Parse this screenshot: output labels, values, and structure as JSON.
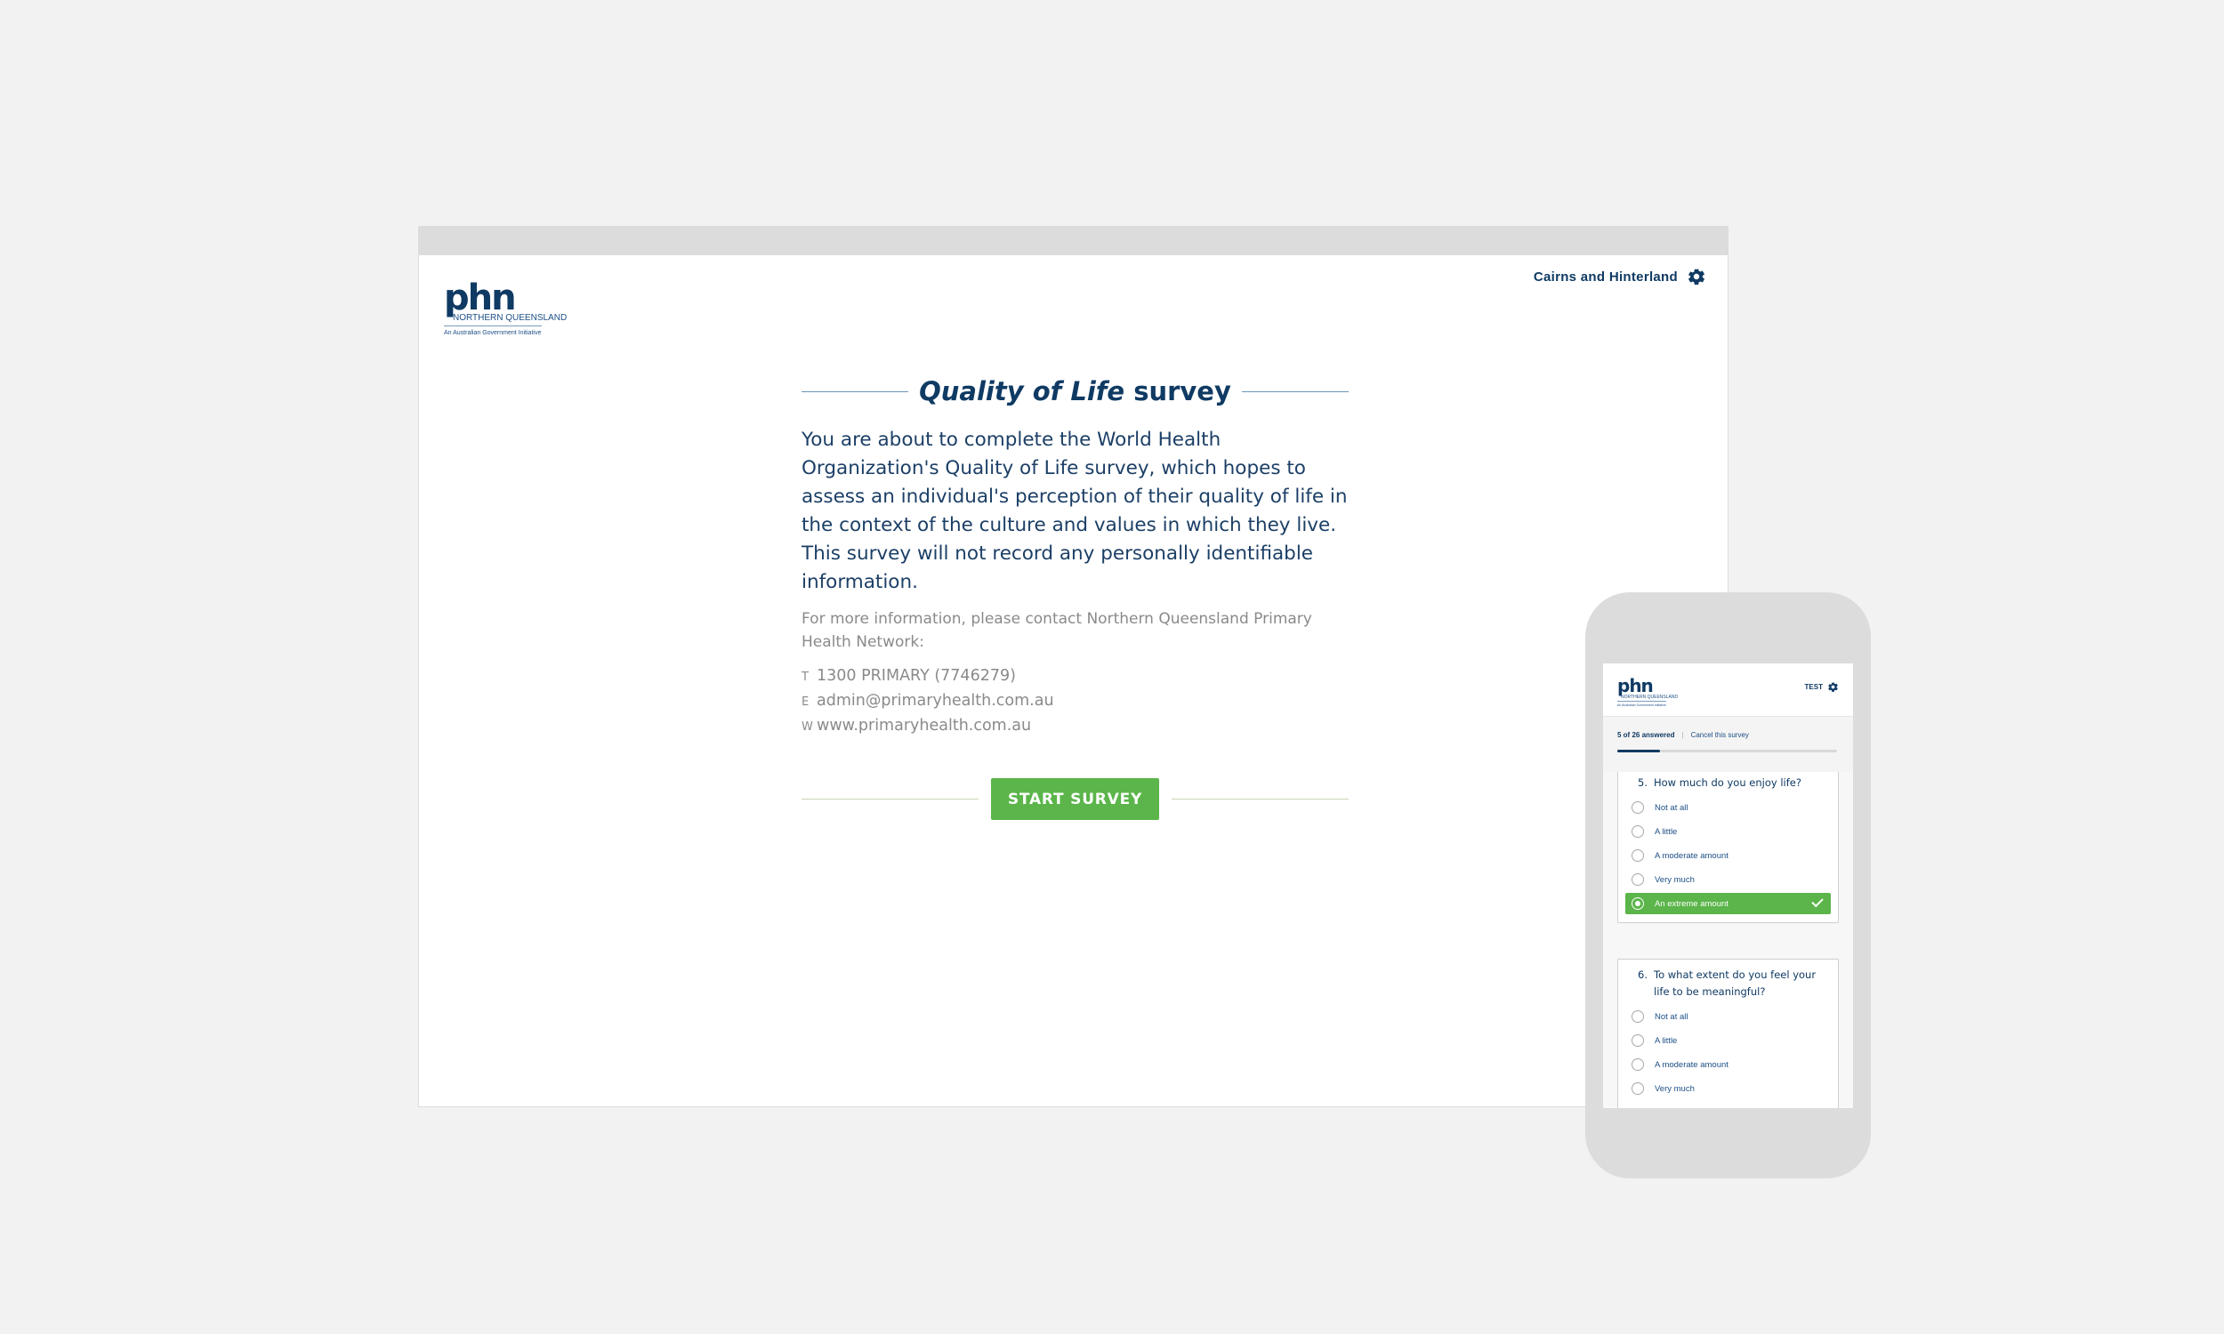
{
  "desktop": {
    "logo": {
      "word": "phn",
      "subtitle": "NORTHERN QUEENSLAND",
      "tagline": "An Australian Government Initiative"
    },
    "region": {
      "label": "Cairns and Hinterland",
      "icon": "gear-icon"
    },
    "title": {
      "emphasis": "Quality of Life",
      "rest": "survey"
    },
    "description": "You are about to complete the World Health Organization's Quality of Life survey, which hopes to assess an individual's perception of their quality of life in the context of the culture and values in which they live. This survey will not record any personally identifiable information.",
    "more_info": "For more information, please contact Northern Queensland Primary Health Network:",
    "contacts": [
      {
        "key": "T",
        "value": "1300 PRIMARY (7746279)"
      },
      {
        "key": "E",
        "value": "admin@primaryhealth.com.au"
      },
      {
        "key": "W",
        "value": "www.primaryhealth.com.au"
      }
    ],
    "start_button": "START SURVEY"
  },
  "mobile": {
    "logo": {
      "word": "phn",
      "subtitle": "NORTHERN QUEENSLAND",
      "tagline": "An Australian Government Initiative"
    },
    "region": {
      "label": "TEST",
      "icon": "gear-icon"
    },
    "progress": {
      "answered_text": "5 of 26 answered",
      "cancel_text": "Cancel this survey",
      "answered": 5,
      "total": 26
    },
    "questions": [
      {
        "number": "5.",
        "text": "How much do you enjoy life?",
        "options": [
          "Not at all",
          "A little",
          "A moderate amount",
          "Very much",
          "An extreme amount"
        ],
        "selected": 4
      },
      {
        "number": "6.",
        "text": "To what extent do you feel your life to be meaningful?",
        "options": [
          "Not at all",
          "A little",
          "A moderate amount",
          "Very much"
        ],
        "selected": -1
      }
    ]
  },
  "colors": {
    "navy": "#0f3a63",
    "green": "#5bb54a",
    "grey_text": "#8a8a8a",
    "background": "#f2f2f2",
    "frame": "#dcdcdc"
  }
}
